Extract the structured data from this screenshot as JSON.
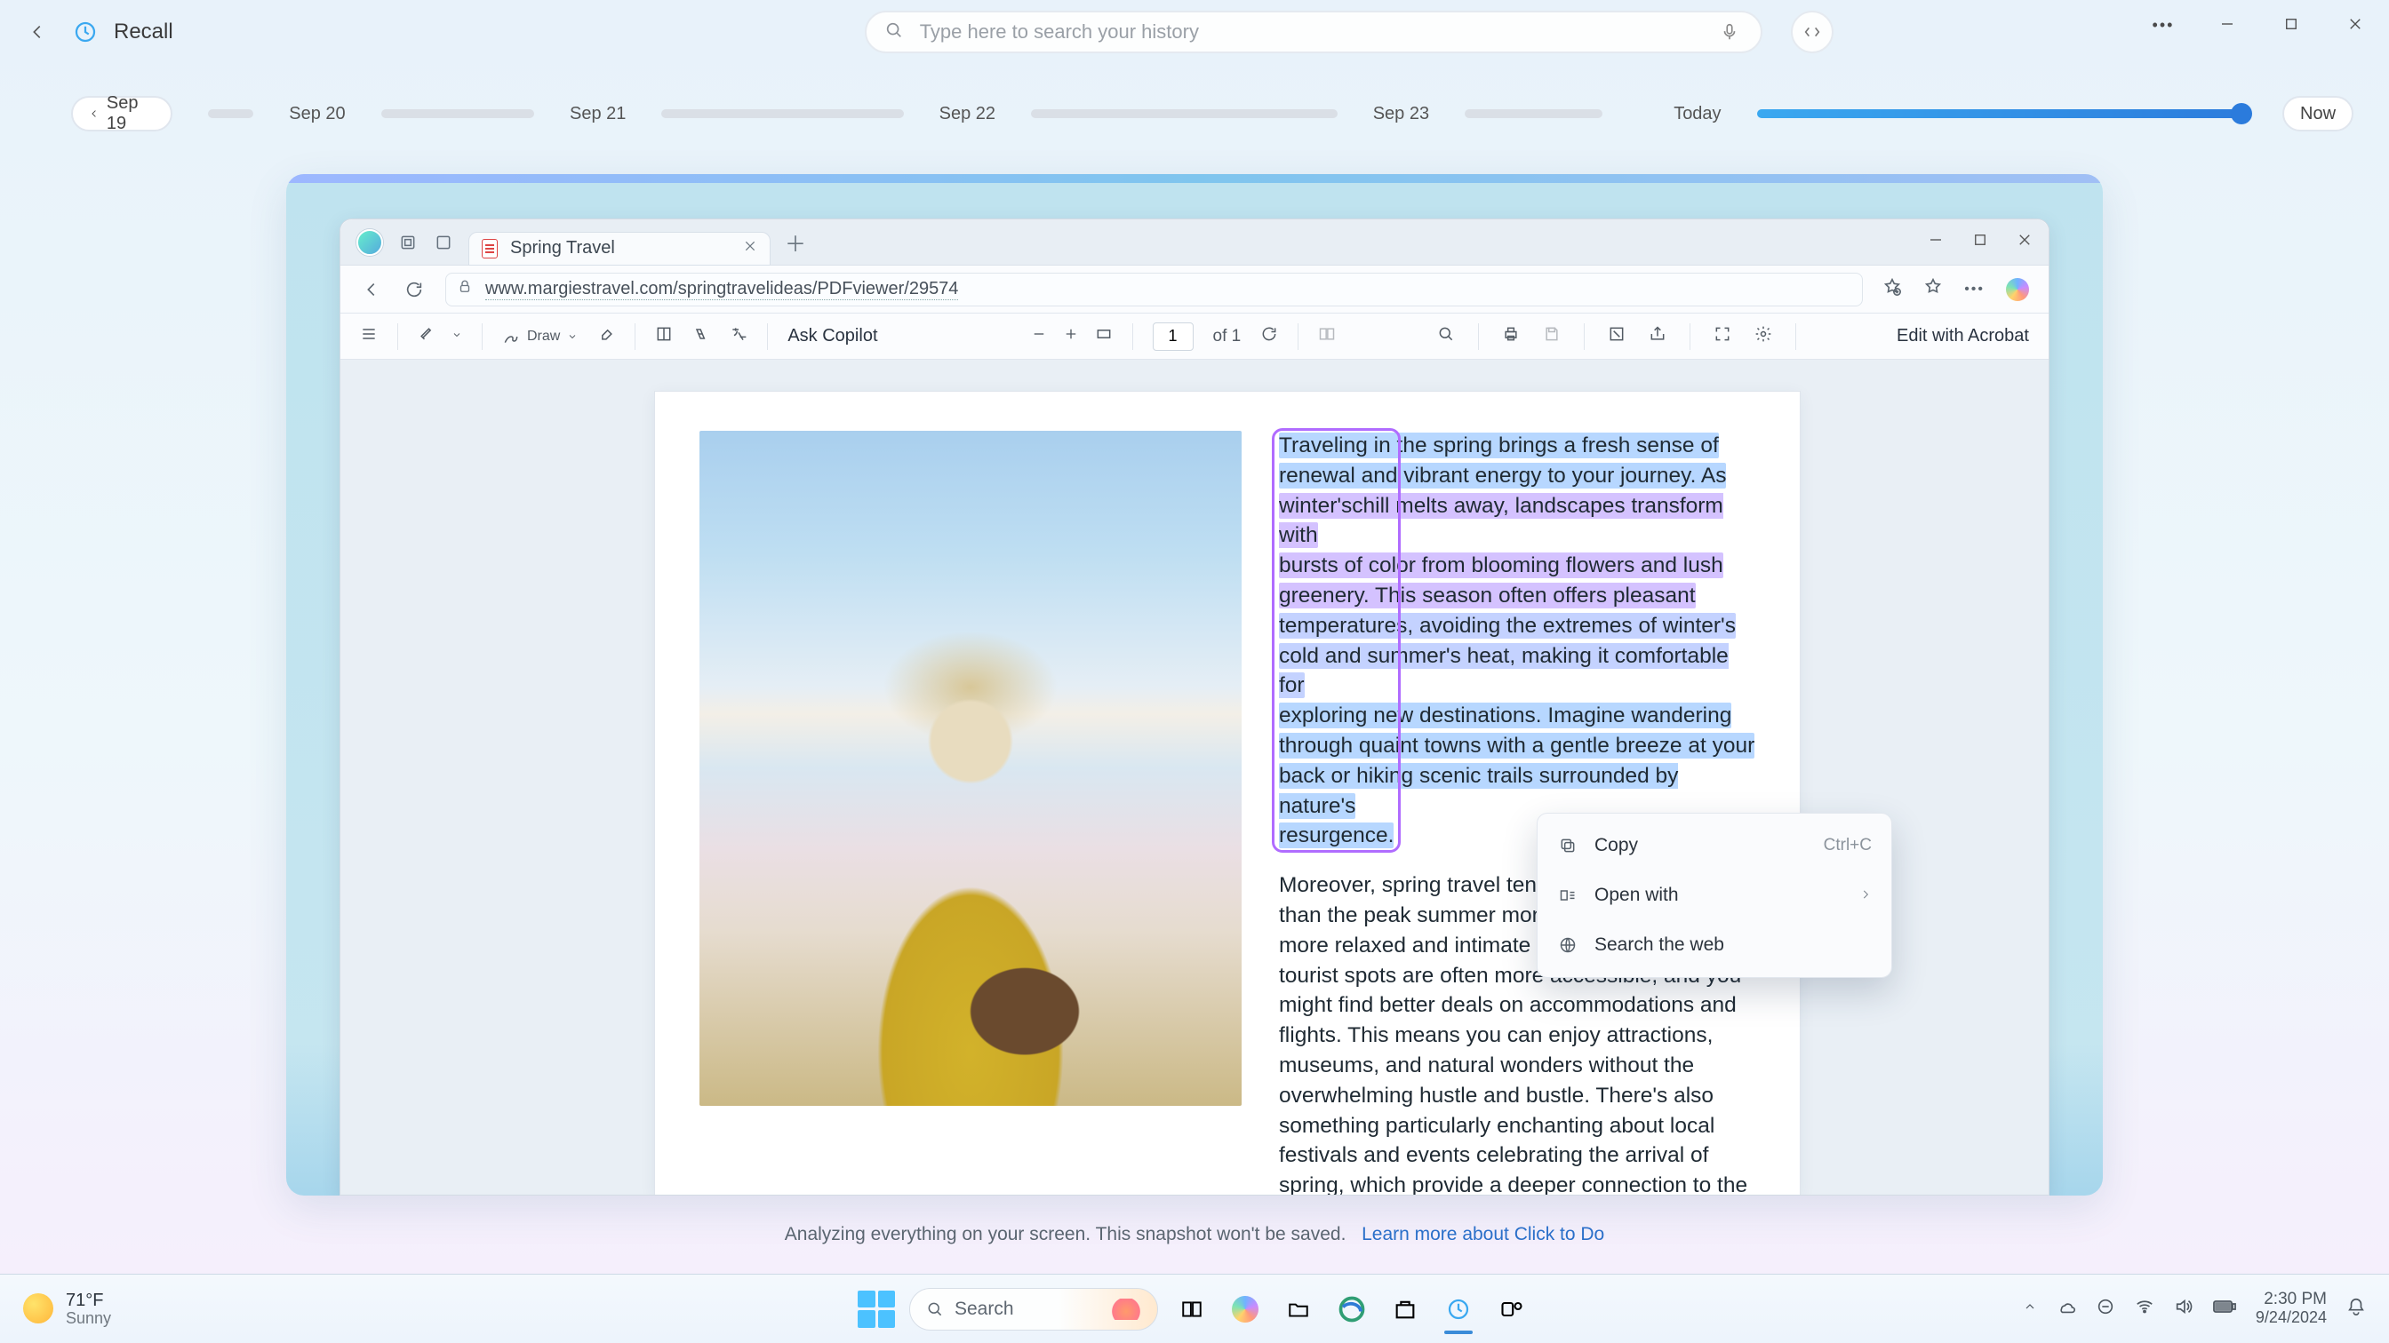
{
  "app": {
    "name": "Recall"
  },
  "search": {
    "placeholder": "Type here to search your history"
  },
  "timeline": {
    "chip": "Sep 19",
    "days": [
      "Sep 20",
      "Sep 21",
      "Sep 22",
      "Sep 23"
    ],
    "bar_widths": [
      60,
      200,
      316,
      400,
      180
    ],
    "today_label": "Today",
    "now_label": "Now"
  },
  "edge": {
    "tab_title": "Spring Travel",
    "url": "www.margiestravel.com/springtravelideas/PDFviewer/29574"
  },
  "pdf_toolbar": {
    "draw": "Draw",
    "ask": "Ask Copilot",
    "page_current": "1",
    "page_of": "of 1",
    "edit": "Edit with Acrobat"
  },
  "doc": {
    "p1_lines": [
      "Traveling in the spring brings a fresh sense of",
      "renewal and vibrant energy to your journey. As",
      "winter'schill melts away, landscapes transform with",
      "bursts of color from blooming flowers and lush",
      "greenery. This season often offers pleasant",
      "temperatures, avoiding the extremes of winter's",
      "cold and summer's heat, making it comfortable for",
      "exploring new destinations. Imagine wandering",
      "through quaint towns with a gentle breeze at your",
      "back or hiking scenic trails surrounded by nature's",
      "resurgence."
    ],
    "p2": "Moreover, spring travel tends to be less crowded than the peak summer months, allowing for a more relaxed and intimate experience. Popular tourist spots are often more accessible, and you might find better deals on accommodations and flights. This means you can enjoy attractions, museums, and natural wonders without the overwhelming hustle and bustle. There's also something particularly enchanting about local festivals and events celebrating the arrival of spring, which provide a deeper connection to the culture and traditions of the place you're visiting."
  },
  "context_menu": {
    "copy": "Copy",
    "copy_kbd": "Ctrl+C",
    "open_with": "Open with",
    "search_web": "Search the web"
  },
  "banner": {
    "text": "Analyzing everything on your screen. This snapshot won't be saved.",
    "link": "Learn more about Click to Do"
  },
  "taskbar": {
    "temp": "71°F",
    "cond": "Sunny",
    "search_label": "Search",
    "time": "2:30 PM",
    "date": "9/24/2024"
  }
}
